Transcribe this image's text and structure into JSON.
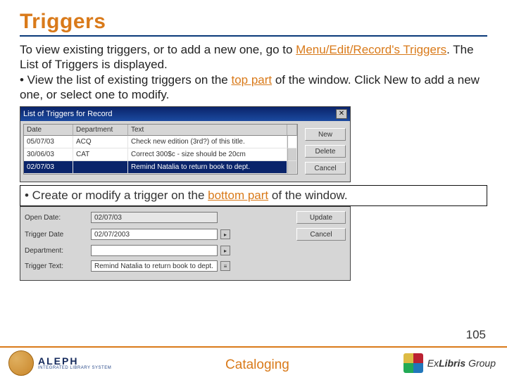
{
  "title": "Triggers",
  "para1_a": "To view existing triggers, or to add a new one, go to ",
  "para1_b": "Menu/Edit/Record's Triggers",
  "para1_c": ". The List of Triggers is displayed.",
  "para2_a": "• View the list of existing triggers on the ",
  "para2_b": "top part",
  "para2_c": " of the window. Click New to add a new one, or select one to modify.",
  "window": {
    "title": "List of Triggers for Record",
    "close": "✕",
    "cols": {
      "c1": "Date",
      "c2": "Department",
      "c3": "Text"
    },
    "rows": [
      {
        "date": "05/07/03",
        "dept": "ACQ",
        "text": "Check new edition (3rd?) of this title."
      },
      {
        "date": "30/06/03",
        "dept": "CAT",
        "text": "Correct 300$c - size should be 20cm"
      },
      {
        "date": "02/07/03",
        "dept": "",
        "text": "Remind Natalia to return book to dept."
      }
    ],
    "buttons": {
      "new": "New",
      "del": "Delete",
      "cancel": "Cancel"
    }
  },
  "mid_a": "• Create or modify a trigger on the ",
  "mid_b": "bottom part",
  "mid_c": " of the window.",
  "form": {
    "open_date_l": "Open Date:",
    "open_date_v": "02/07/03",
    "trig_date_l": "Trigger Date",
    "trig_date_v": "02/07/2003",
    "dept_l": "Department:",
    "dept_v": "",
    "text_l": "Trigger Text:",
    "text_v": "Remind Natalia to return book to dept.",
    "update": "Update",
    "cancel": "Cancel"
  },
  "page_num": "105",
  "footer": {
    "aleph": "ALEPH",
    "aleph_sub": "INTEGRATED LIBRARY SYSTEM",
    "center": "Cataloging",
    "ex_a": "Ex",
    "ex_b": "Libris",
    "ex_c": " Group"
  }
}
